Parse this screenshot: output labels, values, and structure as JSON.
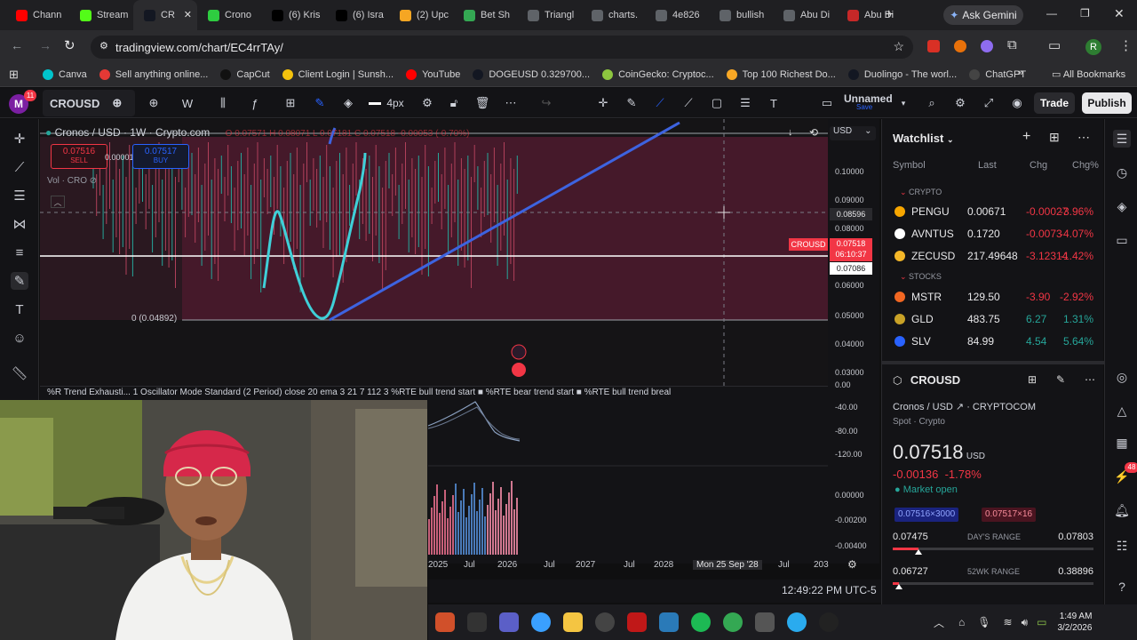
{
  "tabs": [
    {
      "label": "Chann",
      "icon": "youtube-icon",
      "color": "#ff0000"
    },
    {
      "label": "Stream",
      "icon": "green-k-icon",
      "color": "#53fc18"
    },
    {
      "label": "CR",
      "icon": "tradingview-icon",
      "color": "#131722",
      "active": true
    },
    {
      "label": "Crono",
      "icon": "green-circle-icon",
      "color": "#2ecc40"
    },
    {
      "label": "(6) Kris",
      "icon": "x-icon",
      "color": "#000000"
    },
    {
      "label": "(6) Isra",
      "icon": "x-icon",
      "color": "#000000"
    },
    {
      "label": "(2) Upc",
      "icon": "orange-icon",
      "color": "#f5a623"
    },
    {
      "label": "Bet Sh",
      "icon": "maps-pin-icon",
      "color": "#34a853"
    },
    {
      "label": "Triangl",
      "icon": "globe-icon",
      "color": "#5f6368"
    },
    {
      "label": "charts.",
      "icon": "globe-icon",
      "color": "#5f6368"
    },
    {
      "label": "4e826",
      "icon": "globe-icon",
      "color": "#5f6368"
    },
    {
      "label": "bullish",
      "icon": "globe-icon",
      "color": "#5f6368"
    },
    {
      "label": "Abu Di",
      "icon": "globe-icon",
      "color": "#5f6368"
    },
    {
      "label": "Abu Di",
      "icon": "red-circle-icon",
      "color": "#c62828"
    }
  ],
  "browser": {
    "ask_gemini": "Ask Gemini",
    "url": "tradingview.com/chart/EC4rrTAy/",
    "avatar_letter": "R"
  },
  "bookmarks": [
    {
      "label": "Canva",
      "color": "#00c4cc"
    },
    {
      "label": "Sell anything online...",
      "color": "#e53935"
    },
    {
      "label": "CapCut",
      "color": "#111111"
    },
    {
      "label": "Client Login | Sunsh...",
      "color": "#f4c20d"
    },
    {
      "label": "YouTube",
      "color": "#ff0000"
    },
    {
      "label": "DOGEUSD 0.329700...",
      "color": "#131722"
    },
    {
      "label": "CoinGecko: Cryptoc...",
      "color": "#8dc63f"
    },
    {
      "label": "Top 100 Richest Do...",
      "color": "#f9a825"
    },
    {
      "label": "Duolingo - The worl...",
      "color": "#131722"
    },
    {
      "label": "ChatGPT",
      "color": "#444444"
    }
  ],
  "all_bookmarks": "All Bookmarks",
  "tv": {
    "badge": "11",
    "symbol": "CROUSD",
    "interval": "W",
    "stroke": "4px",
    "layout_name": "Unnamed",
    "save": "Save",
    "trade": "Trade",
    "publish": "Publish"
  },
  "legend": {
    "title": "Cronos / USD · 1W · Crypto.com",
    "ohlc": "O 0.07571 H 0.08071 L 0.07181 C 0.07518 -0.00053 (-0.70%)",
    "sell_price": "0.07516",
    "sell_label": "SELL",
    "spread": "0.00001",
    "buy_price": "0.07517",
    "buy_label": "BUY",
    "vol": "Vol · CRO",
    "fib_zero": "0 (0.04892)",
    "currency": "USD"
  },
  "price_axis": [
    "0.10000",
    "0.09000",
    "0.08000",
    "0.07000",
    "0.06000",
    "0.05000",
    "0.04000",
    "0.03000",
    "0.00"
  ],
  "price_tags": {
    "crosshair": "0.08596",
    "symbol_tag": "CROUSD",
    "last": "0.07518",
    "countdown": "06:10:37",
    "white_line": "0.07086"
  },
  "oscillator": {
    "legend": "%R Trend Exhausti...  1 Oscillator Mode Standard (2 Period) close 20 ema 3 21 7 112 3 %RTE bull trend start ■ %RTE bear trend start ■ %RTE bull trend breal",
    "axis": [
      "-40.00",
      "-80.00",
      "-120.00",
      "0.00000",
      "-0.00200",
      "-0.00400"
    ]
  },
  "time_axis": [
    "2025",
    "Jul",
    "2026",
    "Jul",
    "2027",
    "Jul",
    "2028",
    "Mon 25 Sep '28",
    "Jul",
    "203"
  ],
  "clock": "12:49:22 PM UTC-5",
  "watchlist": {
    "title": "Watchlist",
    "headers": [
      "Symbol",
      "Last",
      "Chg",
      "Chg%"
    ],
    "crypto_label": "CRYPTO",
    "stocks_label": "STOCKS",
    "crypto": [
      {
        "sym": "PENGU",
        "last": "0.00671",
        "chg": "-0.00027",
        "pct": "-3.96%",
        "color": "#f7a600"
      },
      {
        "sym": "AVNTUS",
        "last": "0.1720",
        "chg": "-0.0073",
        "pct": "-4.07%",
        "color": "#ffffff"
      },
      {
        "sym": "ZECUSD",
        "last": "217.49648",
        "chg": "-3.12314",
        "pct": "-1.42%",
        "color": "#f4b728"
      }
    ],
    "stocks": [
      {
        "sym": "MSTR",
        "last": "129.50",
        "chg": "-3.90",
        "pct": "-2.92%",
        "color": "#f26722"
      },
      {
        "sym": "GLD",
        "last": "483.75",
        "chg": "6.27",
        "pct": "1.31%",
        "color": "#c9a227"
      },
      {
        "sym": "SLV",
        "last": "84.99",
        "chg": "4.54",
        "pct": "5.64%",
        "color": "#2962ff"
      }
    ]
  },
  "details": {
    "symbol": "CROUSD",
    "name": "Cronos / USD",
    "exchange": "CRYPTOCOM",
    "type": "Spot · Crypto",
    "price": "0.07518",
    "price_unit": "USD",
    "change": "-0.00136",
    "change_pct": "-1.78%",
    "market": "Market open",
    "bid": "0.07516×3000",
    "ask": "0.07517×16",
    "day_low": "0.07475",
    "day_label": "DAY'S RANGE",
    "day_high": "0.07803",
    "day_pos": 0.13,
    "wk_low": "0.06727",
    "wk_label": "52WK RANGE",
    "wk_high": "0.38896",
    "wk_pos": 0.03
  },
  "notification_count": "48",
  "system": {
    "time": "1:49 AM",
    "date": "3/2/2026"
  },
  "colors": {
    "up": "#26a69a",
    "down": "#f23645",
    "accent": "#2962ff",
    "zone": "#5c1f33",
    "pen": "#3fd0d8"
  }
}
